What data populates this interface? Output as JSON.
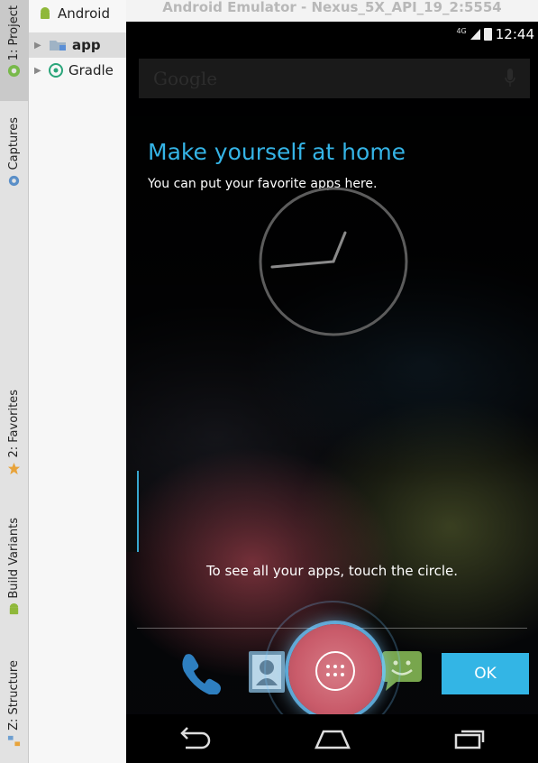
{
  "sidebar": {
    "tabs": [
      {
        "label": "1: Project"
      },
      {
        "label": "Captures"
      },
      {
        "label": "2: Favorites"
      },
      {
        "label": "Build Variants"
      },
      {
        "label": "Z: Structure"
      }
    ]
  },
  "project_panel": {
    "view_mode": "Android",
    "items": [
      {
        "label": "app"
      },
      {
        "label": "Gradle"
      }
    ]
  },
  "emulator": {
    "title": "Android Emulator - Nexus_5X_API_19_2:5554",
    "status_bar": {
      "network": "4G",
      "time": "12:44"
    },
    "search_placeholder": "Google",
    "cling": {
      "title": "Make yourself at home",
      "subtitle": "You can put your favorite apps here."
    },
    "hint": "To see all your apps, touch the circle.",
    "ok_label": "OK",
    "colors": {
      "accent": "#33b5e5",
      "all_apps": "#c95b6a"
    }
  }
}
